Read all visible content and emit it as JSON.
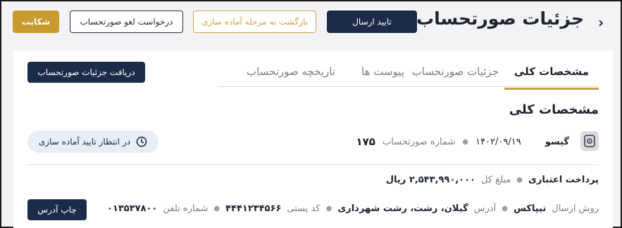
{
  "header": {
    "title": "جزئیات صورتحساب",
    "buttons": {
      "confirm": "تایید ارسال",
      "return": "بازگشت به مرحله آماده سازی",
      "cancel_request": "درخواست لغو صورتحساب",
      "complaint": "شکایت"
    }
  },
  "tabs": [
    {
      "label": "مشخصات کلی",
      "active": true
    },
    {
      "label": "جزئیات صورتحساب",
      "active": false
    },
    {
      "label": "پیوست ها",
      "active": false
    },
    {
      "label": "تاریخچه صورتحساب",
      "active": false
    }
  ],
  "download_button": "دریافت جزئیات صورتحساب",
  "section_title": "مشخصات کلی",
  "summary": {
    "company": "گیسو",
    "date": "۱۴۰۲/۰۹/۱۹",
    "invoice_number_label": "شماره صورتحساب",
    "invoice_number": "۱۷۵",
    "status": "در انتظار تایید آماده سازی"
  },
  "payment": {
    "type": "پرداخت اعتباری",
    "total_label": "مبلغ کل",
    "total_value": "۲,۵۴۳,۹۹۰,۰۰۰ ریال"
  },
  "shipping": {
    "method_label": "روش ارسال",
    "method": "تیپاکس",
    "address_label": "آدرس",
    "address": "گیلان، رشت، رشت شهرداری",
    "postal_label": "کد پستی",
    "postal": "۴۴۴۱۲۳۴۵۶۶",
    "phone_label": "شماره تلفن",
    "phone": "۰۱۳۵۳۷۸۰۰"
  },
  "print_button": "چاپ آدرس",
  "colors": {
    "primary": "#1c2b4a",
    "accent": "#c9a24a",
    "status_bg": "#e8eef8"
  }
}
